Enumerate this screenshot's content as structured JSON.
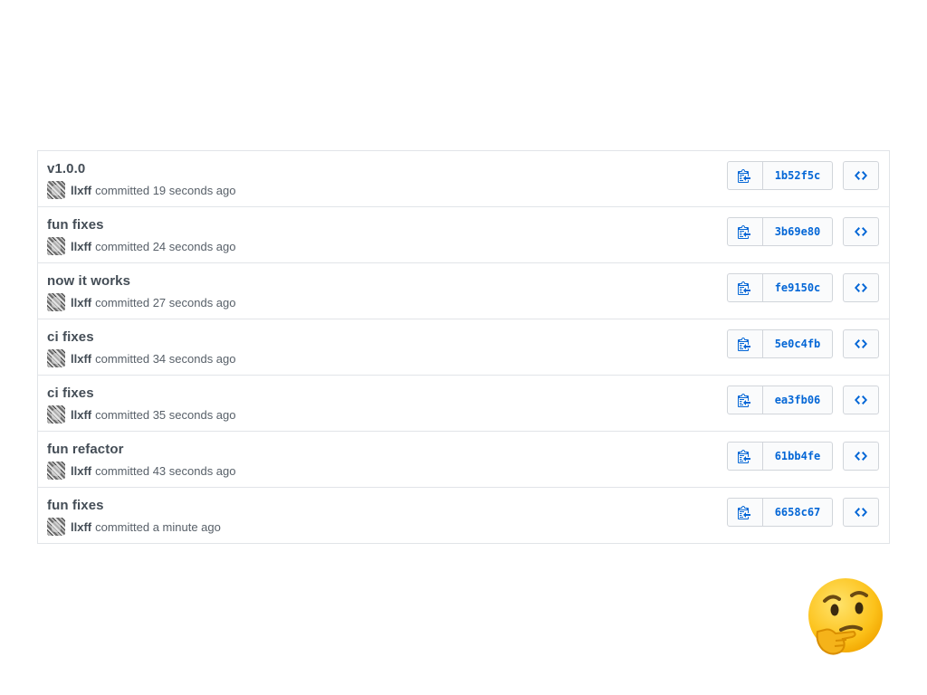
{
  "commits": [
    {
      "title": "v1.0.0",
      "author": "llxff",
      "meta": "committed 19 seconds ago",
      "sha": "1b52f5c"
    },
    {
      "title": "fun fixes",
      "author": "llxff",
      "meta": "committed 24 seconds ago",
      "sha": "3b69e80"
    },
    {
      "title": "now it works",
      "author": "llxff",
      "meta": "committed 27 seconds ago",
      "sha": "fe9150c"
    },
    {
      "title": "ci fixes",
      "author": "llxff",
      "meta": "committed 34 seconds ago",
      "sha": "5e0c4fb"
    },
    {
      "title": "ci fixes",
      "author": "llxff",
      "meta": "committed 35 seconds ago",
      "sha": "ea3fb06"
    },
    {
      "title": "fun refactor",
      "author": "llxff",
      "meta": "committed 43 seconds ago",
      "sha": "61bb4fe"
    },
    {
      "title": "fun fixes",
      "author": "llxff",
      "meta": "committed a minute ago",
      "sha": "6658c67"
    }
  ],
  "icons": {
    "copy": "clipboard-copy-icon",
    "browse": "code-icon",
    "reaction": "thinking-face-emoji"
  },
  "colors": {
    "link": "#0366d6",
    "title": "#444d56",
    "border": "#e1e4e8"
  }
}
